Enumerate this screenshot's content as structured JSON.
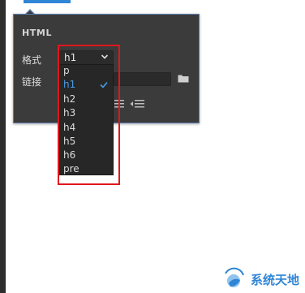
{
  "panel": {
    "title": "HTML",
    "format_label": "格式",
    "link_label": "链接",
    "format_value": "h1",
    "link_value": ""
  },
  "dropdown": {
    "options": [
      "p",
      "h1",
      "h2",
      "h3",
      "h4",
      "h5",
      "h6",
      "pre"
    ],
    "selected": "h1"
  },
  "watermark": {
    "text": "系统天地"
  },
  "colors": {
    "accent": "#2f86d6",
    "highlight": "#e0161c",
    "panel_bg": "#3b3b3b"
  }
}
